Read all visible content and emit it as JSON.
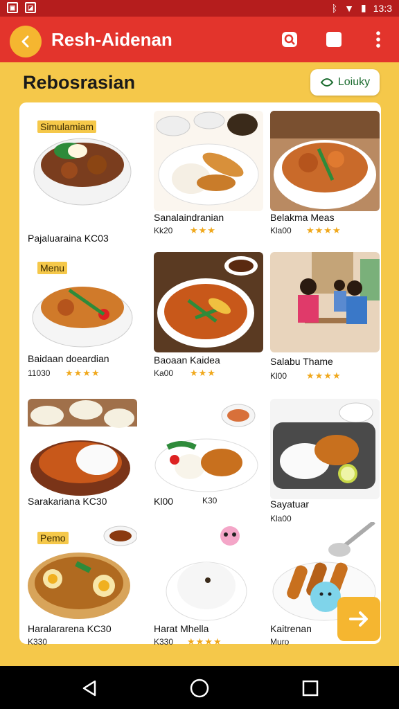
{
  "status": {
    "time": "13:3"
  },
  "appbar": {
    "title": "Resh-Aidenan",
    "back_icon": "back-arrow-icon",
    "search_icon": "search-icon",
    "square_icon": "square-icon",
    "menu_icon": "more-vert-icon"
  },
  "header": {
    "title": "Rebosrasian",
    "chip_label": "Loiuky"
  },
  "cards": [
    {
      "tag": "Simulamiam",
      "name": "Pajaluaraina KC03",
      "price": "",
      "stars": ""
    },
    {
      "tag": "",
      "name": "Sanalaindranian",
      "price": "Kk20",
      "stars": "★★★"
    },
    {
      "tag": "",
      "name": "Belakma Meas",
      "price": "Kla00",
      "stars": "★★★★"
    },
    {
      "tag": "Menu",
      "name": "Baidaan doeardian",
      "price": "11030",
      "stars": "★★★★"
    },
    {
      "tag": "",
      "name": "Baoaan Kaidea",
      "price": "Ka00",
      "stars": "★★★"
    },
    {
      "tag": "",
      "name": "Salabu Thame",
      "price": "Kl00",
      "stars": "★★★★"
    },
    {
      "tag": "",
      "name": "Sarakariana KC30",
      "price": "",
      "stars": ""
    },
    {
      "tag": "",
      "name": "Kl00",
      "price": "K30",
      "stars": ""
    },
    {
      "tag": "",
      "name": "Sayatuar",
      "price": "Kla00",
      "stars": "★★★"
    },
    {
      "tag": "Pemo",
      "name": "Haralararena KC30",
      "price": "K330",
      "stars": ""
    },
    {
      "tag": "",
      "name": "Harat Mhella",
      "price": "K330",
      "stars": "★★★★"
    },
    {
      "tag": "",
      "name": "Kaitrenan",
      "price": "Muro",
      "stars": ""
    }
  ],
  "colors": {
    "appbar": "#e3342c",
    "statusbar": "#b51d1d",
    "background": "#f5c84a",
    "accent": "#f5b630"
  }
}
